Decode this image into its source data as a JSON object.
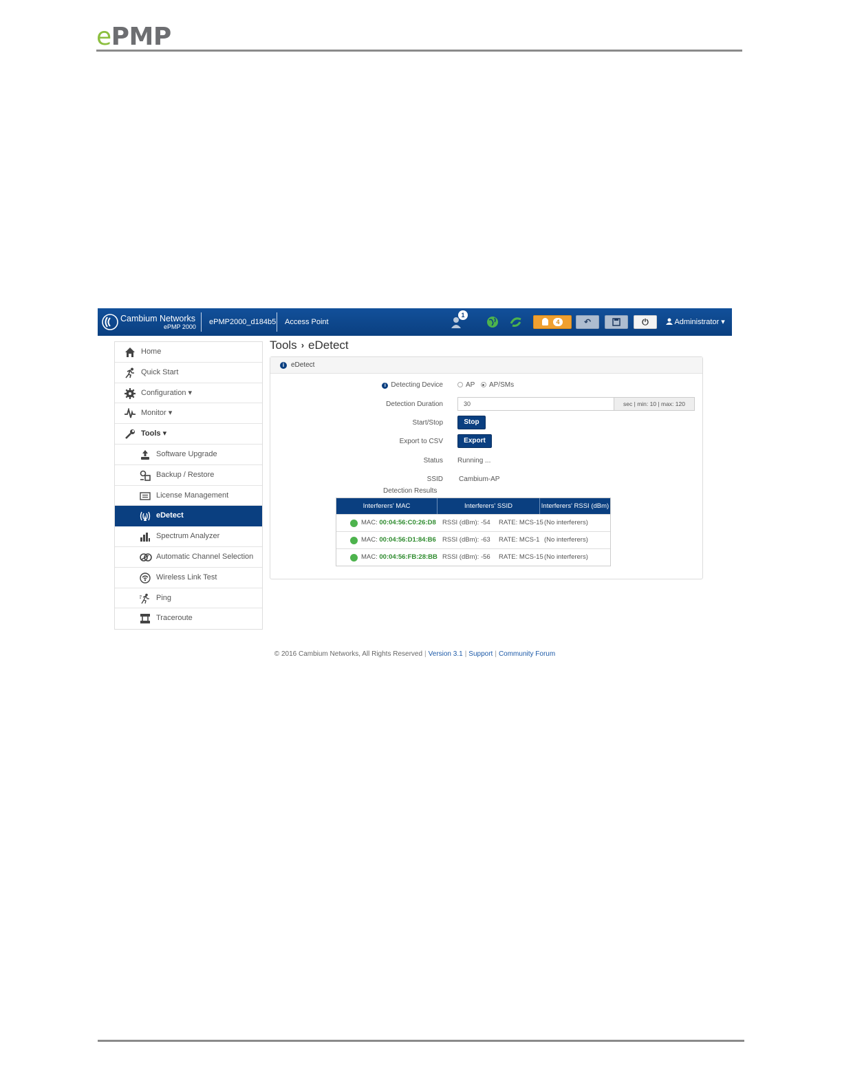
{
  "document": {
    "logo_e": "e",
    "logo_pmp": "PMP"
  },
  "topbar": {
    "brand_name": "Cambium Networks",
    "brand_sub": "ePMP 2000",
    "device_name": "ePMP2000_d184b5",
    "mode": "Access Point",
    "user_badge": "1",
    "alert_count": "4",
    "admin_label": "Administrator ▾"
  },
  "sidebar": {
    "items": [
      {
        "label": "Home",
        "icon": "home-icon"
      },
      {
        "label": "Quick Start",
        "icon": "running-icon"
      },
      {
        "label": "Configuration ▾",
        "icon": "gear-icon"
      },
      {
        "label": "Monitor ▾",
        "icon": "pulse-icon"
      },
      {
        "label": "Tools ▾",
        "icon": "wrench-icon"
      },
      {
        "label": "Software Upgrade",
        "icon": "upgrade-icon"
      },
      {
        "label": "Backup / Restore",
        "icon": "backup-icon"
      },
      {
        "label": "License Management",
        "icon": "license-icon"
      },
      {
        "label": "eDetect",
        "icon": "edetect-icon"
      },
      {
        "label": "Spectrum Analyzer",
        "icon": "bar-chart-icon"
      },
      {
        "label": "Automatic Channel Selection",
        "icon": "channel-icon"
      },
      {
        "label": "Wireless Link Test",
        "icon": "wifi-icon"
      },
      {
        "label": "Ping",
        "icon": "ping-icon"
      },
      {
        "label": "Traceroute",
        "icon": "traceroute-icon"
      }
    ]
  },
  "breadcrumb": {
    "section": "Tools",
    "separator": "›",
    "page": "eDetect"
  },
  "panel": {
    "title": "eDetect",
    "detecting_device_label": "Detecting Device",
    "option_ap": "AP",
    "option_ap_sms": "AP/SMs",
    "selected_option": "AP/SMs",
    "duration_label": "Detection Duration",
    "duration_value": "30",
    "duration_hint": "sec | min: 10 | max: 120",
    "start_stop_label": "Start/Stop",
    "stop_button": "Stop",
    "export_label": "Export to CSV",
    "export_button": "Export",
    "status_label": "Status",
    "status_value": "Running ...",
    "ssid_label": "SSID",
    "ssid_value": "Cambium-AP",
    "results_label": "Detection Results"
  },
  "results": {
    "columns": [
      "Interferers' MAC",
      "Interferers' SSID",
      "Interferers' RSSI (dBm)"
    ],
    "rows": [
      {
        "mac_prefix": "MAC:",
        "mac": "00:04:56:C0:26:D8",
        "rssi": "RSSI (dBm): -54",
        "rate": "RATE: MCS-15",
        "note": "(No interferers)"
      },
      {
        "mac_prefix": "MAC:",
        "mac": "00:04:56:D1:84:B6",
        "rssi": "RSSI (dBm): -63",
        "rate": "RATE: MCS-1",
        "note": "(No interferers)"
      },
      {
        "mac_prefix": "MAC:",
        "mac": "00:04:56:FB:28:BB",
        "rssi": "RSSI (dBm): -56",
        "rate": "RATE: MCS-15",
        "note": "(No interferers)"
      }
    ]
  },
  "footer": {
    "copyright": "© 2016 Cambium Networks, All Rights Reserved",
    "version": "Version 3.1",
    "support": "Support",
    "forum": "Community Forum"
  },
  "colors": {
    "navy": "#0a3f80",
    "brand_green": "#8cbf3f",
    "alert_orange": "#f0a030",
    "status_green": "#4db34d"
  }
}
